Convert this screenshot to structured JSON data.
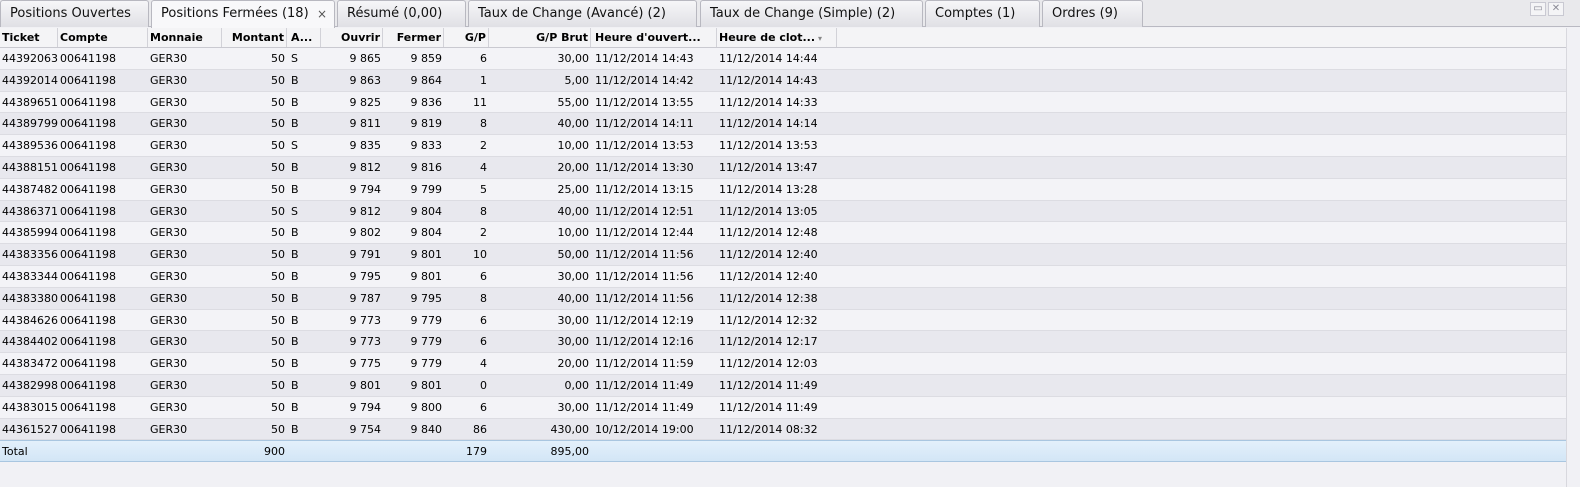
{
  "tabs": [
    {
      "label": "Positions Ouvertes"
    },
    {
      "label": "Positions Fermées (18)"
    },
    {
      "label": "Résumé (0,00)"
    },
    {
      "label": "Taux de Change (Avancé) (2)"
    },
    {
      "label": "Taux de Change (Simple) (2)"
    },
    {
      "label": "Comptes (1)"
    },
    {
      "label": "Ordres (9)"
    }
  ],
  "tab_close_glyph": "×",
  "window_buttons": {
    "restore_icon": "restore-icon",
    "close_icon": "close-icon"
  },
  "columns": [
    "Ticket",
    "Compte",
    "Monnaie",
    "Montant",
    "A...",
    "Ouvrir",
    "Fermer",
    "G/P",
    "G/P Brut",
    "Heure d'ouvert...",
    "Heure de clot..."
  ],
  "sort_glyph": "▾",
  "rows": [
    [
      "44392063",
      "00641198",
      "GER30",
      "50",
      "S",
      "9 865",
      "9 859",
      "6",
      "30,00",
      "11/12/2014 14:43",
      "11/12/2014 14:44"
    ],
    [
      "44392014",
      "00641198",
      "GER30",
      "50",
      "B",
      "9 863",
      "9 864",
      "1",
      "5,00",
      "11/12/2014 14:42",
      "11/12/2014 14:43"
    ],
    [
      "44389651",
      "00641198",
      "GER30",
      "50",
      "B",
      "9 825",
      "9 836",
      "11",
      "55,00",
      "11/12/2014 13:55",
      "11/12/2014 14:33"
    ],
    [
      "44389799",
      "00641198",
      "GER30",
      "50",
      "B",
      "9 811",
      "9 819",
      "8",
      "40,00",
      "11/12/2014 14:11",
      "11/12/2014 14:14"
    ],
    [
      "44389536",
      "00641198",
      "GER30",
      "50",
      "S",
      "9 835",
      "9 833",
      "2",
      "10,00",
      "11/12/2014 13:53",
      "11/12/2014 13:53"
    ],
    [
      "44388151",
      "00641198",
      "GER30",
      "50",
      "B",
      "9 812",
      "9 816",
      "4",
      "20,00",
      "11/12/2014 13:30",
      "11/12/2014 13:47"
    ],
    [
      "44387482",
      "00641198",
      "GER30",
      "50",
      "B",
      "9 794",
      "9 799",
      "5",
      "25,00",
      "11/12/2014 13:15",
      "11/12/2014 13:28"
    ],
    [
      "44386371",
      "00641198",
      "GER30",
      "50",
      "S",
      "9 812",
      "9 804",
      "8",
      "40,00",
      "11/12/2014 12:51",
      "11/12/2014 13:05"
    ],
    [
      "44385994",
      "00641198",
      "GER30",
      "50",
      "B",
      "9 802",
      "9 804",
      "2",
      "10,00",
      "11/12/2014 12:44",
      "11/12/2014 12:48"
    ],
    [
      "44383356",
      "00641198",
      "GER30",
      "50",
      "B",
      "9 791",
      "9 801",
      "10",
      "50,00",
      "11/12/2014 11:56",
      "11/12/2014 12:40"
    ],
    [
      "44383344",
      "00641198",
      "GER30",
      "50",
      "B",
      "9 795",
      "9 801",
      "6",
      "30,00",
      "11/12/2014 11:56",
      "11/12/2014 12:40"
    ],
    [
      "44383380",
      "00641198",
      "GER30",
      "50",
      "B",
      "9 787",
      "9 795",
      "8",
      "40,00",
      "11/12/2014 11:56",
      "11/12/2014 12:38"
    ],
    [
      "44384626",
      "00641198",
      "GER30",
      "50",
      "B",
      "9 773",
      "9 779",
      "6",
      "30,00",
      "11/12/2014 12:19",
      "11/12/2014 12:32"
    ],
    [
      "44384402",
      "00641198",
      "GER30",
      "50",
      "B",
      "9 773",
      "9 779",
      "6",
      "30,00",
      "11/12/2014 12:16",
      "11/12/2014 12:17"
    ],
    [
      "44383472",
      "00641198",
      "GER30",
      "50",
      "B",
      "9 775",
      "9 779",
      "4",
      "20,00",
      "11/12/2014 11:59",
      "11/12/2014 12:03"
    ],
    [
      "44382998",
      "00641198",
      "GER30",
      "50",
      "B",
      "9 801",
      "9 801",
      "0",
      "0,00",
      "11/12/2014 11:49",
      "11/12/2014 11:49"
    ],
    [
      "44383015",
      "00641198",
      "GER30",
      "50",
      "B",
      "9 794",
      "9 800",
      "6",
      "30,00",
      "11/12/2014 11:49",
      "11/12/2014 11:49"
    ],
    [
      "44361527",
      "00641198",
      "GER30",
      "50",
      "B",
      "9 754",
      "9 840",
      "86",
      "430,00",
      "10/12/2014 19:00",
      "11/12/2014 08:32"
    ]
  ],
  "total": {
    "label": "Total",
    "montant": "900",
    "gp": "179",
    "gp_brut": "895,00"
  }
}
